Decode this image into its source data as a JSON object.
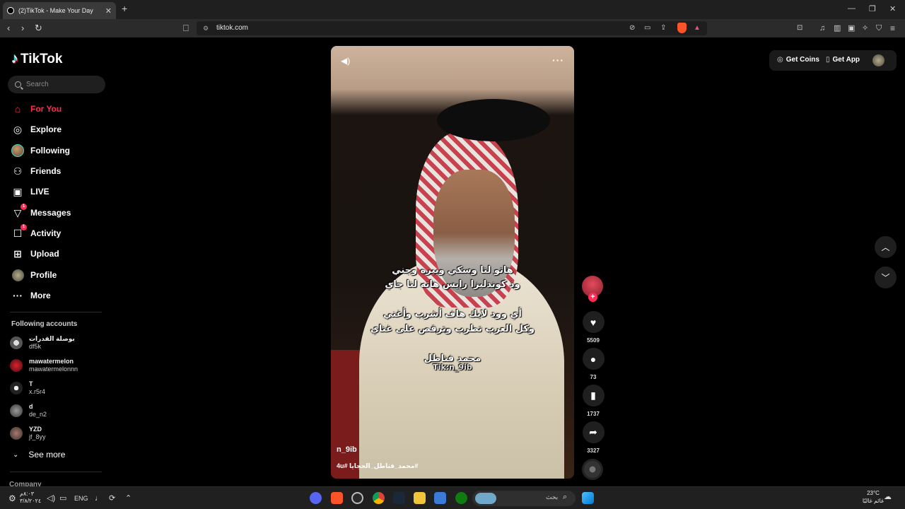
{
  "browser": {
    "tab_title": "(2)TikTok - Make Your Day",
    "tab_close": "✕",
    "new_tab": "+",
    "url": "tiktok.com"
  },
  "sidebar": {
    "logo_text": "TikTok",
    "search_placeholder": "Search",
    "nav": [
      {
        "label": "For You",
        "icon": "home-icon",
        "active": true
      },
      {
        "label": "Explore",
        "icon": "compass-icon"
      },
      {
        "label": "Following",
        "icon": "following-avatar-icon"
      },
      {
        "label": "Friends",
        "icon": "friends-icon"
      },
      {
        "label": "LIVE",
        "icon": "live-icon"
      },
      {
        "label": "Messages",
        "icon": "messages-icon",
        "badge": "1"
      },
      {
        "label": "Activity",
        "icon": "activity-icon",
        "badge": "1"
      },
      {
        "label": "Upload",
        "icon": "upload-icon"
      },
      {
        "label": "Profile",
        "icon": "profile-avatar-icon"
      },
      {
        "label": "More",
        "icon": "more-icon"
      }
    ],
    "following_title": "Following accounts",
    "accounts": [
      {
        "name": "بوصلة القدرات",
        "username": "df5k"
      },
      {
        "name": "mawatermelon",
        "username": "mawatermelonnn"
      },
      {
        "name": "T",
        "username": "x.r5r4"
      },
      {
        "name": "d",
        "username": "de_n2"
      },
      {
        "name": "YZD",
        "username": "jf_8yy"
      }
    ],
    "see_more": "See more",
    "company": "Company"
  },
  "video": {
    "lyrics": [
      "هاتو لنا وسكي وبيره وجني",
      "وذ كوندليزا رايس هاته لنا جاي",
      "أي وود لايك هاف أشرب وأغني",
      "وكل العرب تطرب وترقص على غناي",
      "محمد فناطل",
      "Tik:n_9ib"
    ],
    "username": "n_9ib",
    "caption": "#محمد_فناطل_الحجايا #4u"
  },
  "actions": {
    "likes": "5509",
    "comments": "73",
    "saves": "1737",
    "shares": "3327"
  },
  "topbar": {
    "get_coins": "Get Coins",
    "get_app": "Get App"
  },
  "taskbar": {
    "time_line1": "٨:٠٣م",
    "time_line2": "٣/٨/٢٠٢٤",
    "lang": "ENG",
    "search": "بحث",
    "weather_temp": "23°C",
    "weather_desc": "غائم غالبًا",
    "clock_line1": "٨:٠٣ م",
    "clock_line2": "٢٠٢٤/٨/٣"
  },
  "colors": {
    "accent": "#fe2c55",
    "bg": "#000000",
    "surface": "#1f1f1f"
  }
}
